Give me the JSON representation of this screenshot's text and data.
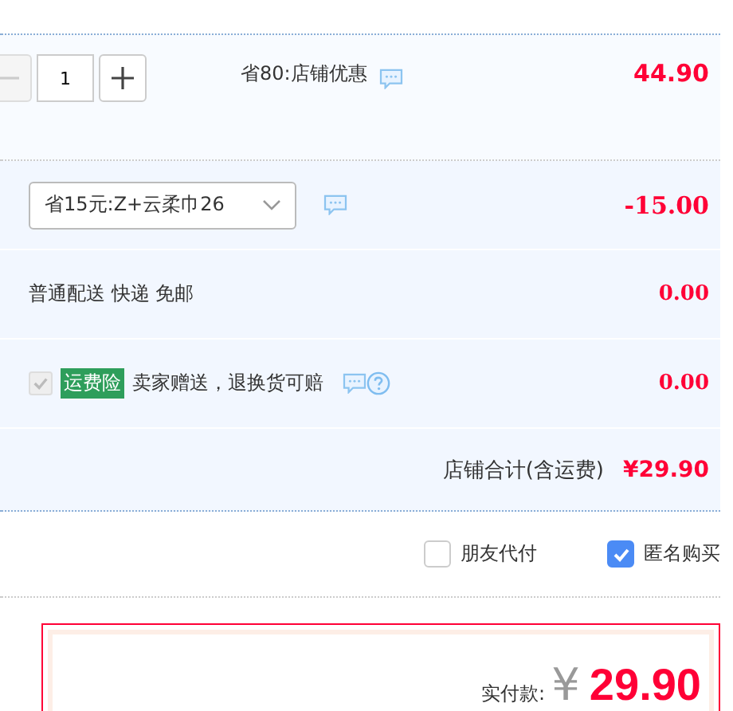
{
  "item": {
    "stepper": {
      "value": "1",
      "decrement_disabled": true
    },
    "promo": "省80:店铺优惠",
    "price": "44.90"
  },
  "coupon": {
    "value": "省15元:Z+云柔巾26",
    "amount": "-15.00"
  },
  "shipping": {
    "text": "普通配送 快递 免邮",
    "amount": "0.00"
  },
  "insurance": {
    "checked": true,
    "disabled": true,
    "badge": "运费险",
    "text": "卖家赠送，退换货可赔",
    "amount": "0.00"
  },
  "shop_total": {
    "label": "店铺合计(含运费)",
    "amount": "¥29.90"
  },
  "options": [
    {
      "label": "朋友代付",
      "checked": false
    },
    {
      "label": "匿名购买",
      "checked": true
    }
  ],
  "payment": {
    "label": "实付款:",
    "currency": "¥",
    "amount": "29.90"
  }
}
